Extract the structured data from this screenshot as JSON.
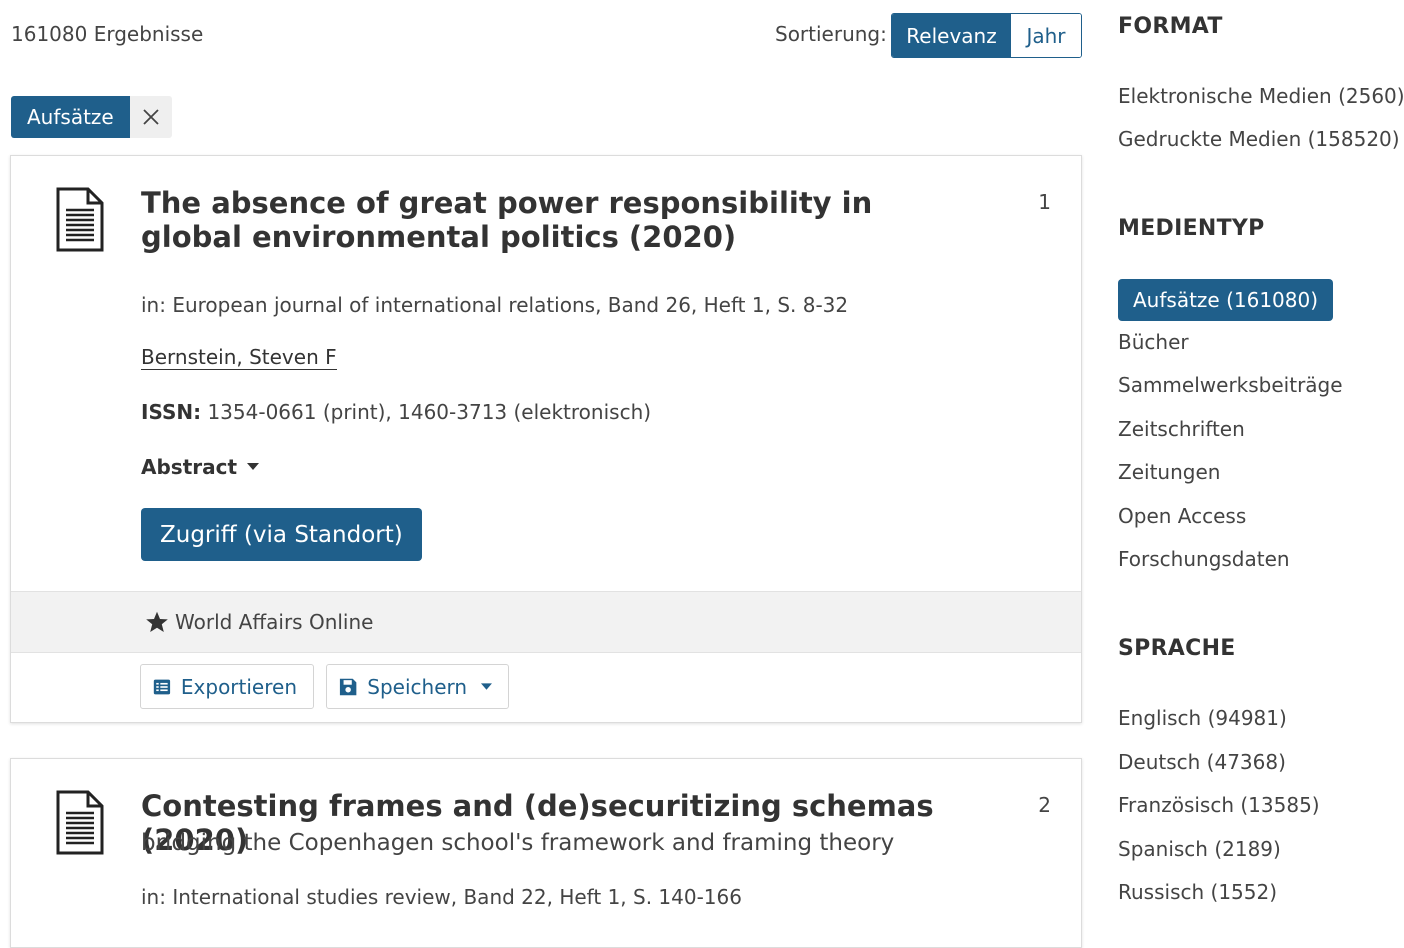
{
  "header": {
    "result_count": "161080 Ergebnisse",
    "sort_label": "Sortierung:",
    "sort_options": [
      "Relevanz",
      "Jahr"
    ],
    "sort_selected": "Relevanz"
  },
  "active_filter": {
    "label": "Aufsätze",
    "remove_icon": "close-icon"
  },
  "results": [
    {
      "rank": "1",
      "icon": "document-icon",
      "title": "The absence of great power responsibility in global environmental politics (2020)",
      "in": "in: European journal of international relations, Band 26, Heft 1, S. 8-32",
      "author": "Bernstein, Steven F",
      "issn_label": "ISSN:",
      "issn_value": "1354-0661 (print), 1460-3713 (elektronisch)",
      "abstract_label": "Abstract",
      "access_label": "Zugriff (via Standort)",
      "source": "World Affairs Online",
      "export_label": "Exportieren",
      "save_label": "Speichern"
    },
    {
      "rank": "2",
      "icon": "document-icon",
      "title": "Contesting frames and (de)securitizing schemas (2020)",
      "subtitle": "bridging the Copenhagen school's framework and framing theory",
      "in": "in: International studies review, Band 22, Heft 1, S. 140-166"
    }
  ],
  "facets": {
    "format": {
      "heading": "FORMAT",
      "items": [
        "Elektronische Medien (2560)",
        "Gedruckte Medien (158520)"
      ]
    },
    "medientyp": {
      "heading": "MEDIENTYP",
      "active": "Aufsätze (161080)",
      "items": [
        "Bücher",
        "Sammelwerksbeiträge",
        "Zeitschriften",
        "Zeitungen",
        "Open Access",
        "Forschungsdaten"
      ]
    },
    "sprache": {
      "heading": "SPRACHE",
      "items": [
        "Englisch (94981)",
        "Deutsch (47368)",
        "Französisch (13585)",
        "Spanisch (2189)",
        "Russisch (1552)"
      ]
    }
  },
  "colors": {
    "accent": "#1f5f8b",
    "text": "#333333",
    "muted_bg": "#f2f2f2"
  }
}
